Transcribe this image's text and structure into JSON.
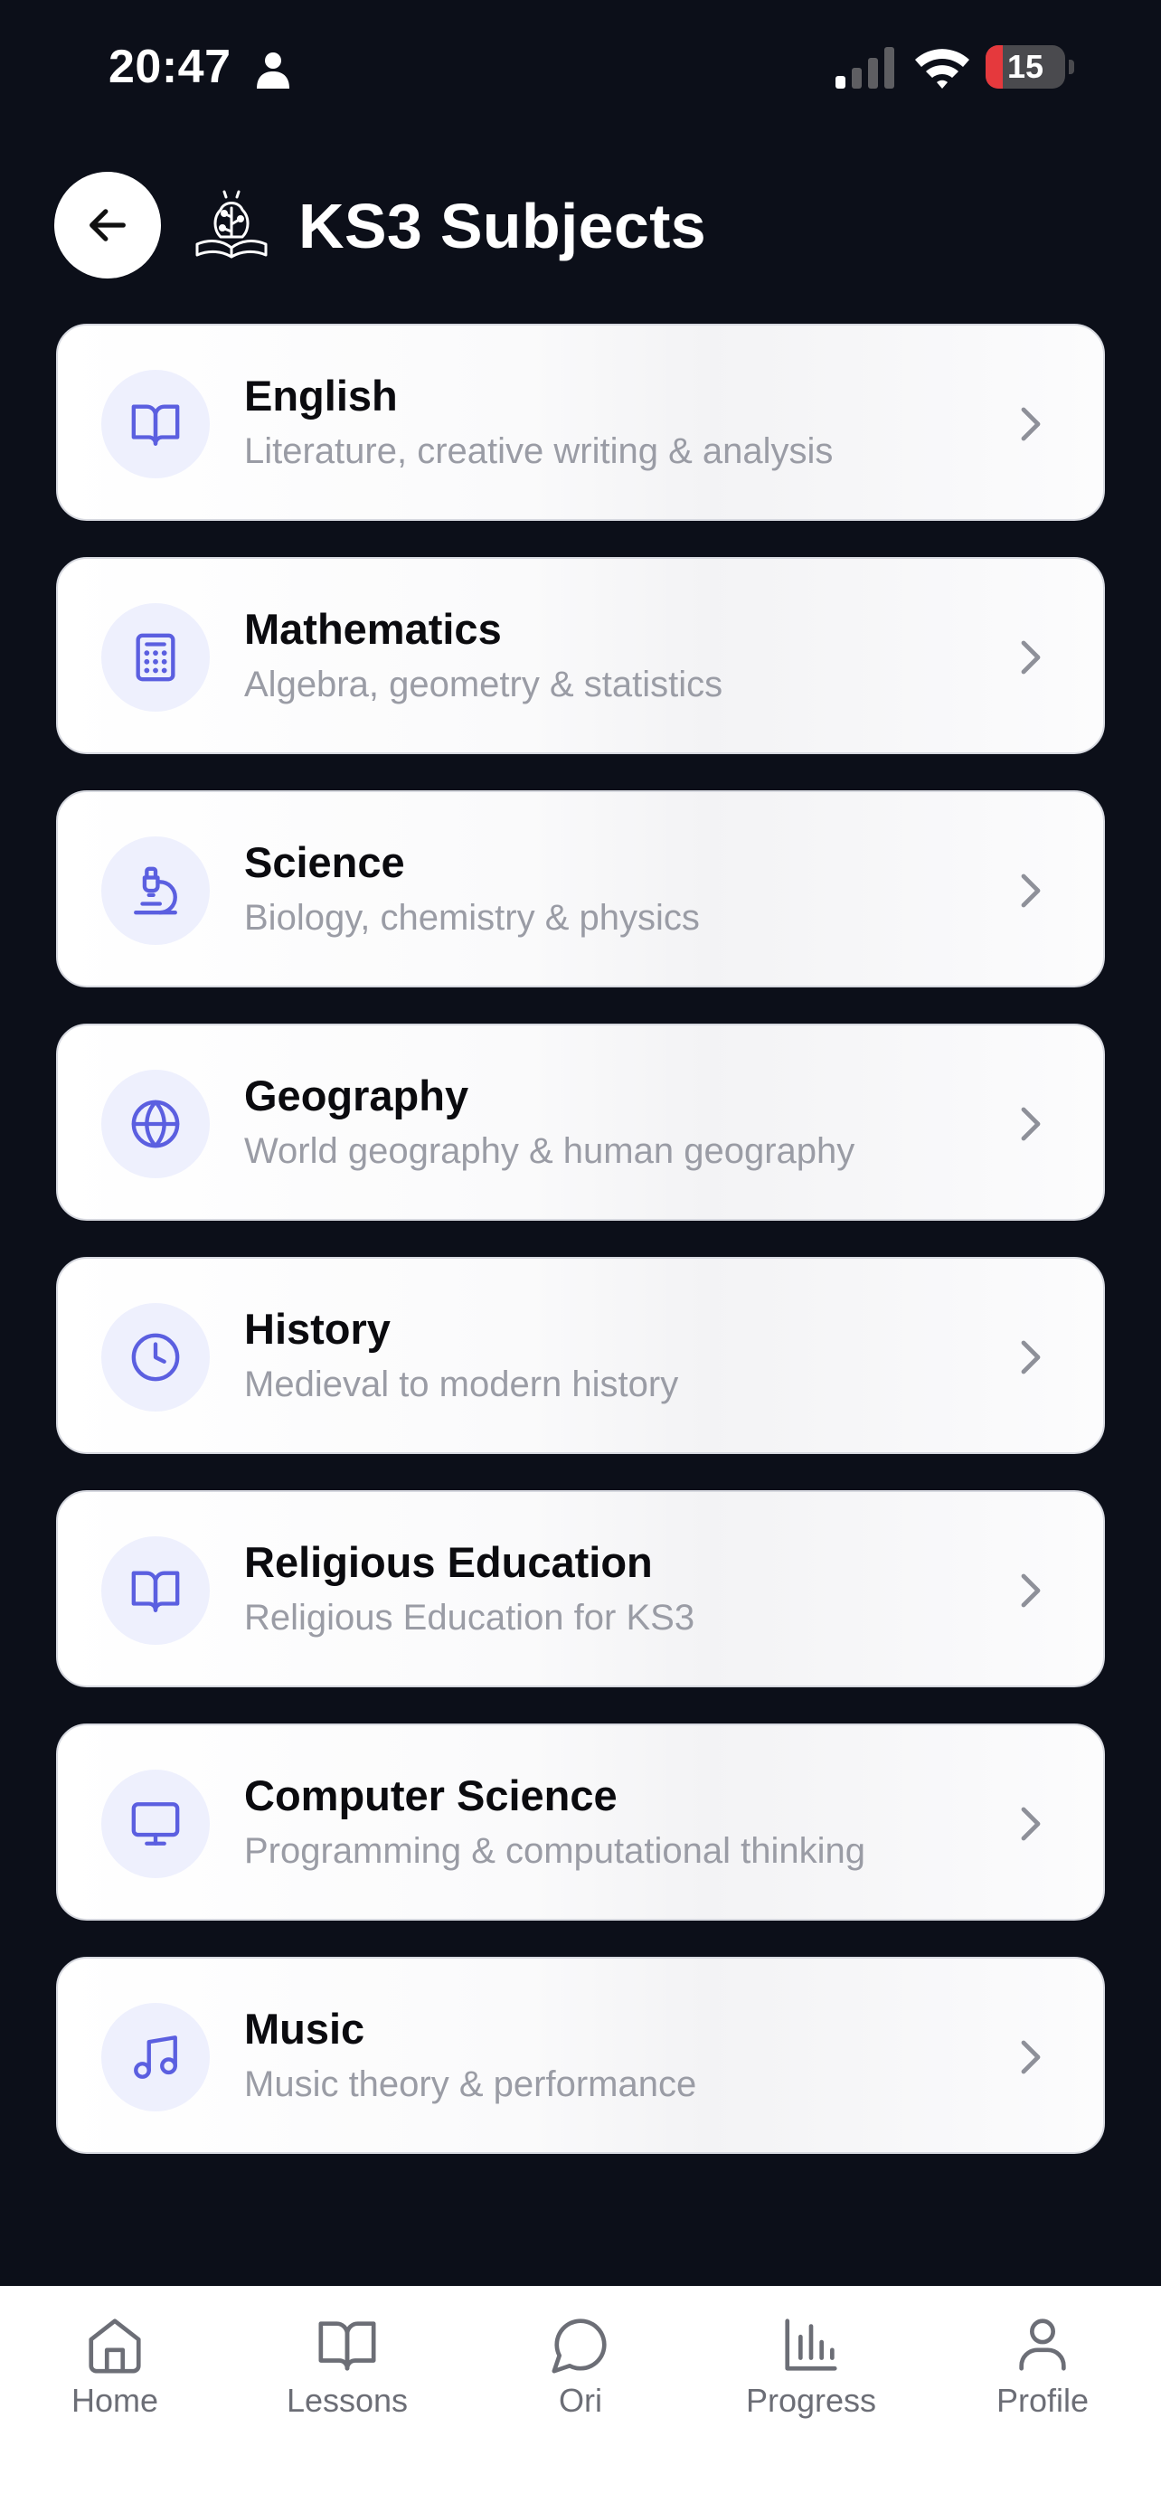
{
  "status_bar": {
    "time": "20:47",
    "battery": "15",
    "battery_level": 0.15
  },
  "header": {
    "title": "KS3 Subjects"
  },
  "colors": {
    "accent": "#5b5fe0",
    "icon_bg": "#eef0fd",
    "background": "#0c0f19",
    "battery_low": "#e5393d"
  },
  "subjects": [
    {
      "name": "English",
      "description": "Literature, creative writing & analysis",
      "icon": "book-icon"
    },
    {
      "name": "Mathematics",
      "description": "Algebra, geometry & statistics",
      "icon": "calculator-icon"
    },
    {
      "name": "Science",
      "description": "Biology, chemistry & physics",
      "icon": "microscope-icon"
    },
    {
      "name": "Geography",
      "description": "World geography & human geography",
      "icon": "globe-icon"
    },
    {
      "name": "History",
      "description": "Medieval to modern history",
      "icon": "clock-icon"
    },
    {
      "name": "Religious Education",
      "description": "Religious Education for KS3",
      "icon": "book-icon"
    },
    {
      "name": "Computer Science",
      "description": "Programming & computational thinking",
      "icon": "monitor-icon"
    },
    {
      "name": "Music",
      "description": "Music theory & performance",
      "icon": "music-note-icon"
    }
  ],
  "nav": [
    {
      "label": "Home",
      "icon": "home-icon"
    },
    {
      "label": "Lessons",
      "icon": "book-open-icon"
    },
    {
      "label": "Ori",
      "icon": "chat-bubble-icon"
    },
    {
      "label": "Progress",
      "icon": "bar-chart-icon"
    },
    {
      "label": "Profile",
      "icon": "user-icon"
    }
  ]
}
